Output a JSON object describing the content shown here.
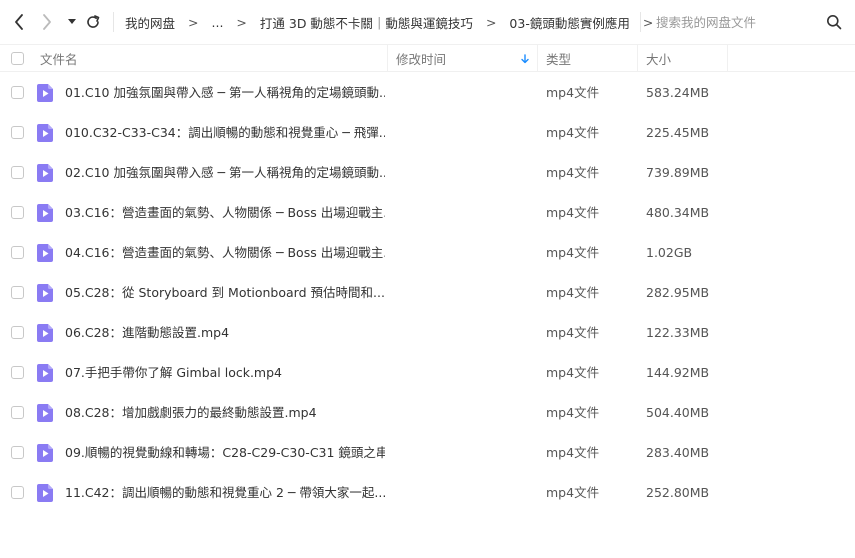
{
  "nav": {
    "back_icon": "chevron-left-icon",
    "forward_icon": "chevron-right-icon",
    "history_icon": "caret-down-icon",
    "refresh_icon": "refresh-icon"
  },
  "breadcrumb": {
    "root": "我的网盘",
    "ellipsis": "...",
    "items": [
      "打通 3D 動態不卡關｜動態與運鏡技巧",
      "03-鏡頭動態實例應用"
    ],
    "separator": ">"
  },
  "search": {
    "placeholder": "搜索我的网盘文件",
    "icon": "search-icon"
  },
  "columns": {
    "name": "文件名",
    "time": "修改时间",
    "type": "类型",
    "size": "大小"
  },
  "colors": {
    "file_icon": "#8a7bf3",
    "sort_arrow": "#1a8cff",
    "divider": "#f0f0f0"
  },
  "files": [
    {
      "name": "01.C10 加強氛圍與帶入感 ─ 第一人稱視角的定場鏡頭動...",
      "type": "mp4文件",
      "size": "583.24MB"
    },
    {
      "name": "010.C32-C33-C34：調出順暢的動態和視覺重心 ─ 飛彈...",
      "type": "mp4文件",
      "size": "225.45MB"
    },
    {
      "name": "02.C10 加強氛圍與帶入感 ─ 第一人稱視角的定場鏡頭動...",
      "type": "mp4文件",
      "size": "739.89MB"
    },
    {
      "name": "03.C16：營造畫面的氣勢、人物關係 ─ Boss 出場迎戰主...",
      "type": "mp4文件",
      "size": "480.34MB"
    },
    {
      "name": "04.C16：營造畫面的氣勢、人物關係 ─ Boss 出場迎戰主...",
      "type": "mp4文件",
      "size": "1.02GB"
    },
    {
      "name": "05.C28：從 Storyboard 到 Motionboard 預估時間和...",
      "type": "mp4文件",
      "size": "282.95MB"
    },
    {
      "name": "06.C28：進階動態設置.mp4",
      "type": "mp4文件",
      "size": "122.33MB"
    },
    {
      "name": "07.手把手帶你了解 Gimbal lock.mp4",
      "type": "mp4文件",
      "size": "144.92MB"
    },
    {
      "name": "08.C28：增加戲劇張力的最終動態設置.mp4",
      "type": "mp4文件",
      "size": "504.40MB"
    },
    {
      "name": "09.順暢的視覺動線和轉場：C28-C29-C30-C31 鏡頭之串...",
      "type": "mp4文件",
      "size": "283.40MB"
    },
    {
      "name": "11.C42：調出順暢的動態和視覺重心 2 ─ 帶領大家一起...",
      "type": "mp4文件",
      "size": "252.80MB"
    }
  ]
}
